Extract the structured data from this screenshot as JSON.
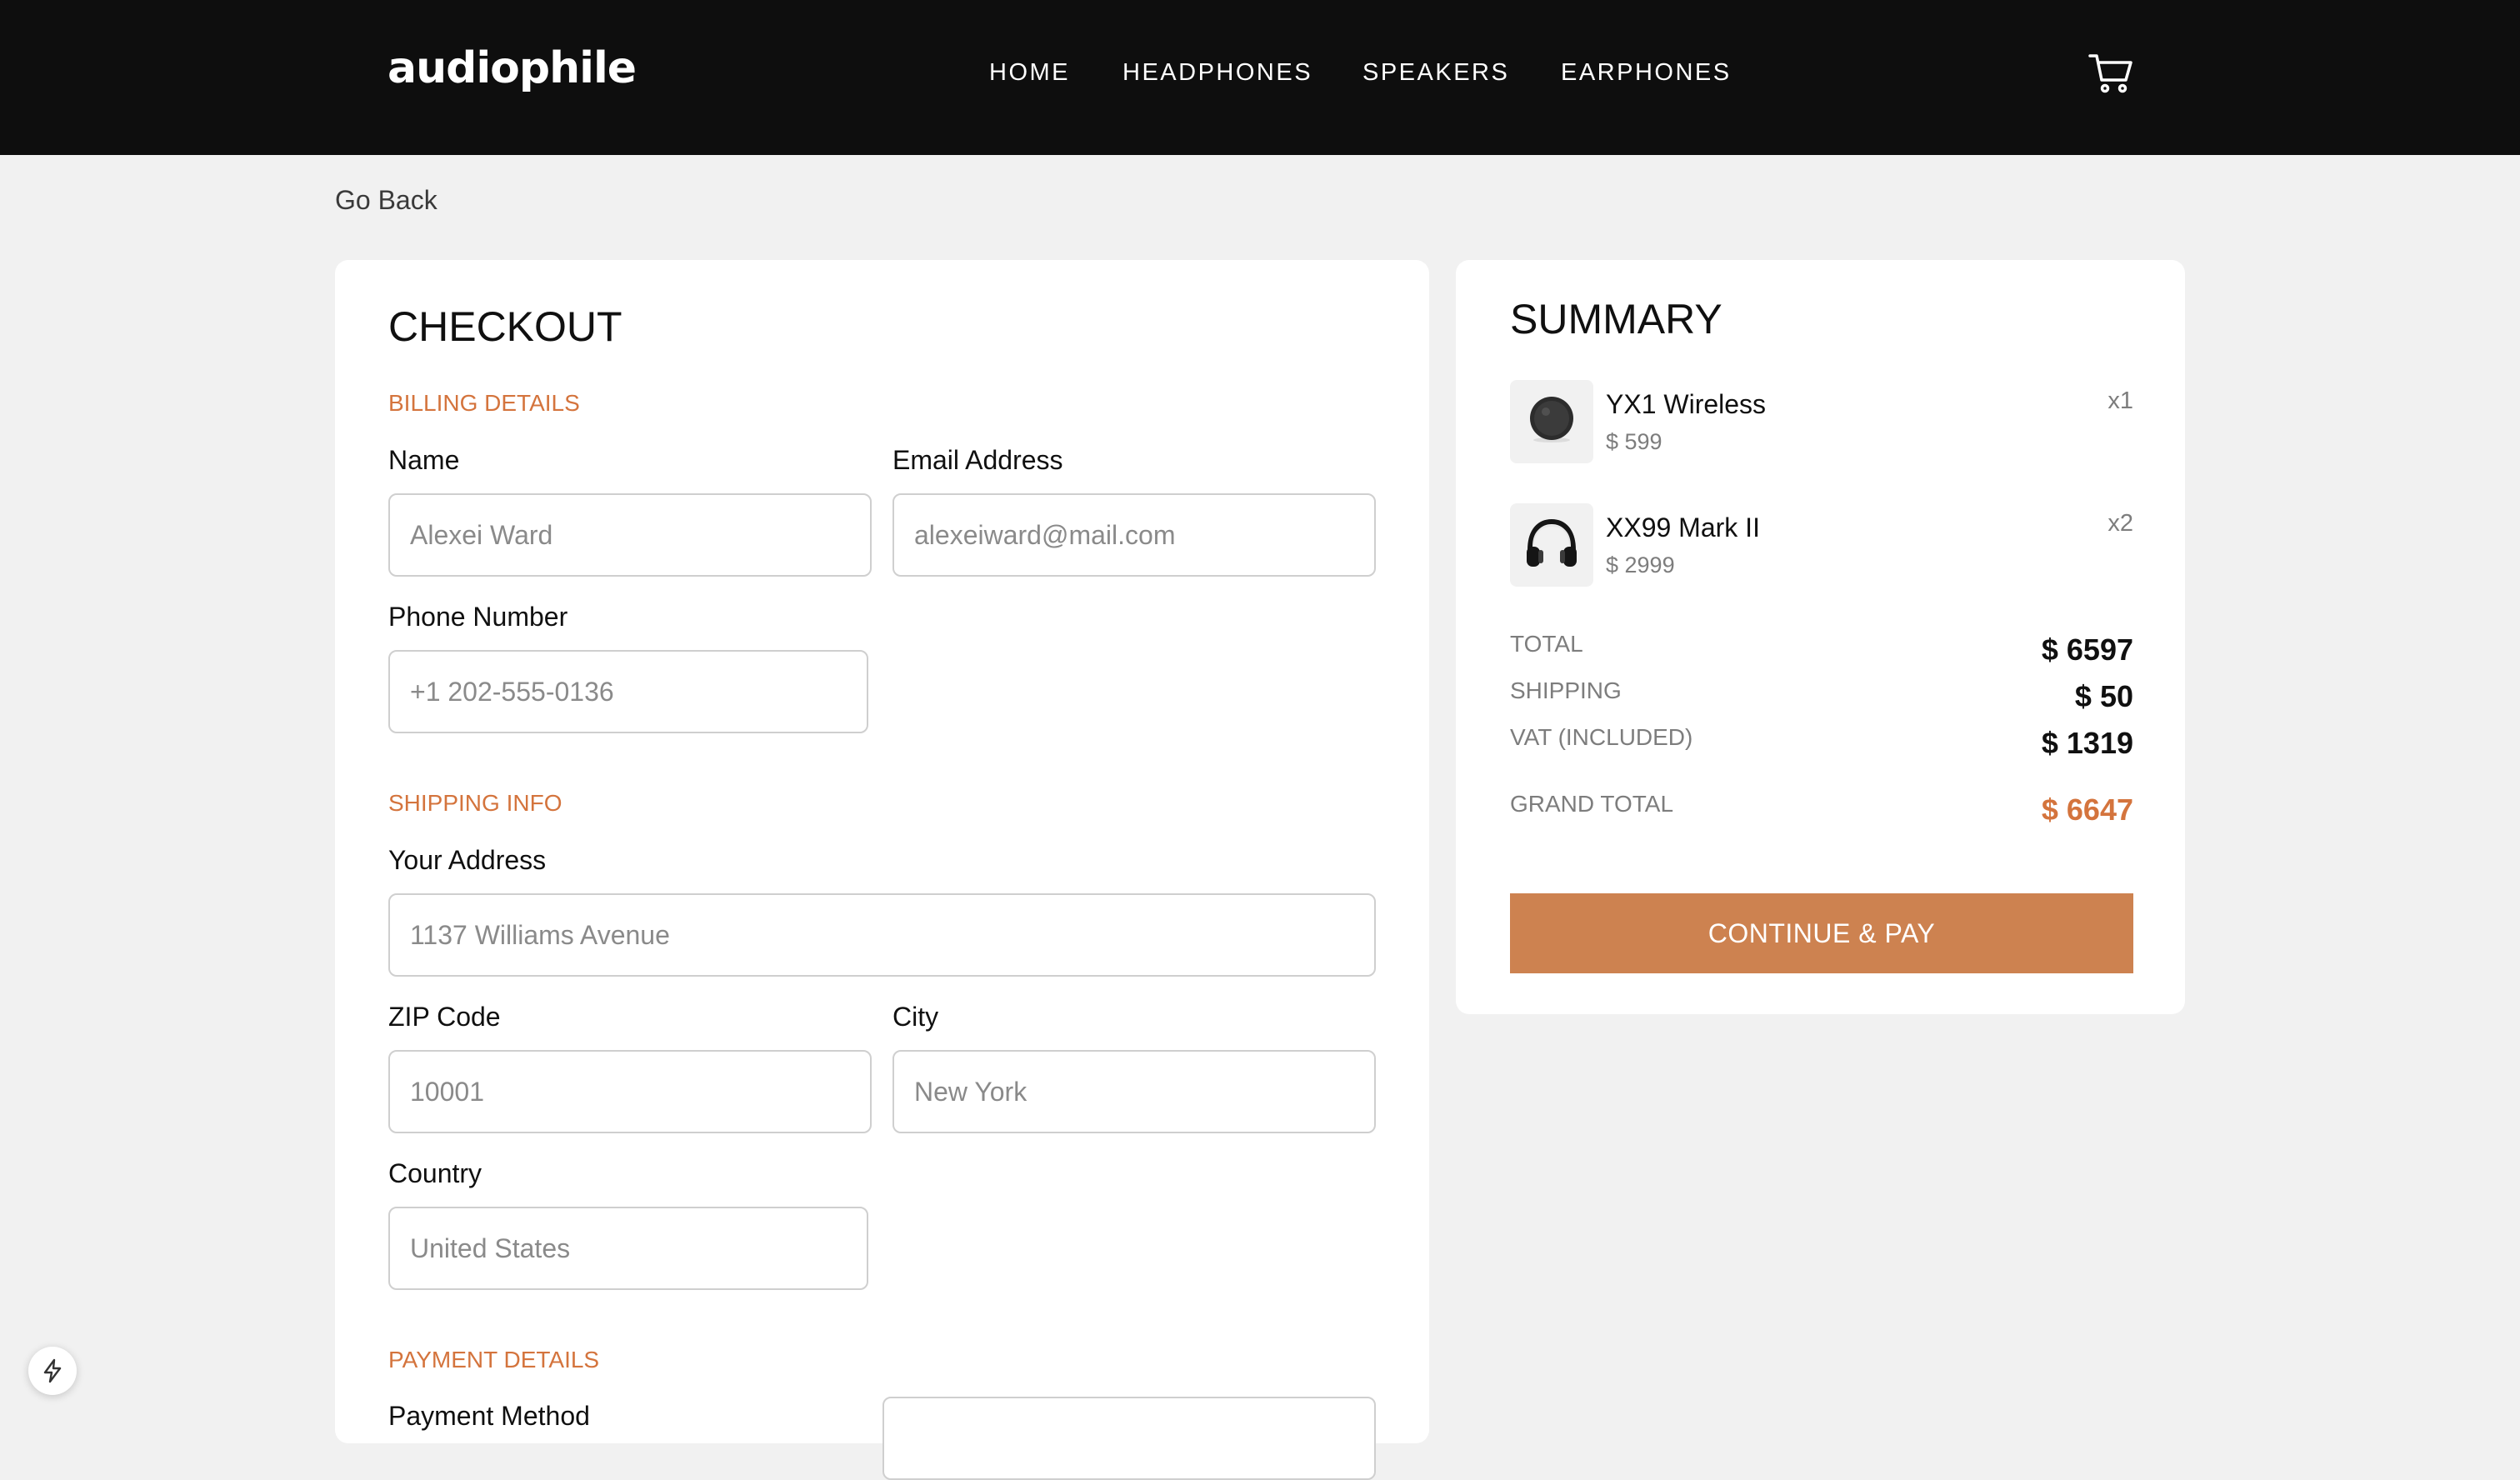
{
  "header": {
    "logo": "audiophile",
    "nav": [
      "HOME",
      "HEADPHONES",
      "SPEAKERS",
      "EARPHONES"
    ],
    "cart_icon": "cart-icon"
  },
  "go_back": "Go Back",
  "checkout": {
    "title": "CHECKOUT",
    "billing": {
      "heading": "BILLING DETAILS",
      "name_label": "Name",
      "name_placeholder": "Alexei Ward",
      "email_label": "Email Address",
      "email_placeholder": "alexeiward@mail.com",
      "phone_label": "Phone Number",
      "phone_placeholder": "+1 202-555-0136"
    },
    "shipping": {
      "heading": "SHIPPING INFO",
      "address_label": "Your Address",
      "address_placeholder": "1137 Williams Avenue",
      "zip_label": "ZIP Code",
      "zip_placeholder": "10001",
      "city_label": "City",
      "city_placeholder": "New York",
      "country_label": "Country",
      "country_placeholder": "United States"
    },
    "payment": {
      "heading": "PAYMENT DETAILS",
      "method_label": "Payment Method"
    }
  },
  "summary": {
    "title": "SUMMARY",
    "items": [
      {
        "name": "YX1 Wireless",
        "price": "$ 599",
        "qty": "x1",
        "icon": "earphones-thumbnail"
      },
      {
        "name": "XX99 Mark II",
        "price": "$ 2999",
        "qty": "x2",
        "icon": "headphones-thumbnail"
      }
    ],
    "total_label": "TOTAL",
    "total_value": "$ 6597",
    "shipping_label": "SHIPPING",
    "shipping_value": "$ 50",
    "vat_label": "VAT (INCLUDED)",
    "vat_value": "$ 1319",
    "grand_total_label": "GRAND TOTAL",
    "grand_total_value": "$ 6647",
    "pay_button": "CONTINUE & PAY"
  },
  "colors": {
    "accent": "#d4743d",
    "button": "#cd8250",
    "header_bg": "#0e0e0e",
    "page_bg": "#f1f1f1"
  },
  "floating_badge_icon": "lightning-icon"
}
